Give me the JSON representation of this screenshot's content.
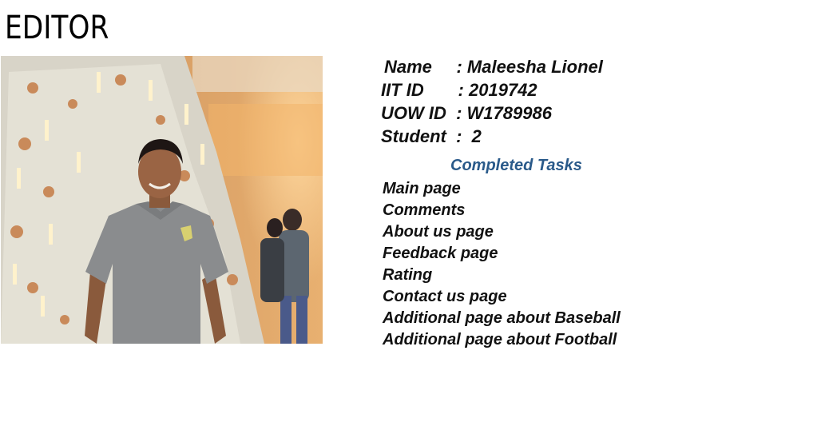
{
  "page": {
    "title": "EDITOR"
  },
  "profile": {
    "name_line": "Name     : Maleesha Lionel",
    "iit_line": "IIT ID       : 2019742",
    "uow_line": "UOW ID  : W1789986",
    "student_line": "Student  :  2"
  },
  "tasks": {
    "heading": "Completed Tasks",
    "heading_color": "#2a5a8a",
    "items": [
      "Main page",
      "Comments",
      "About us page",
      "Feedback page",
      "Rating",
      "Contact us page",
      "Additional page about Baseball",
      "Additional page about Football"
    ]
  }
}
